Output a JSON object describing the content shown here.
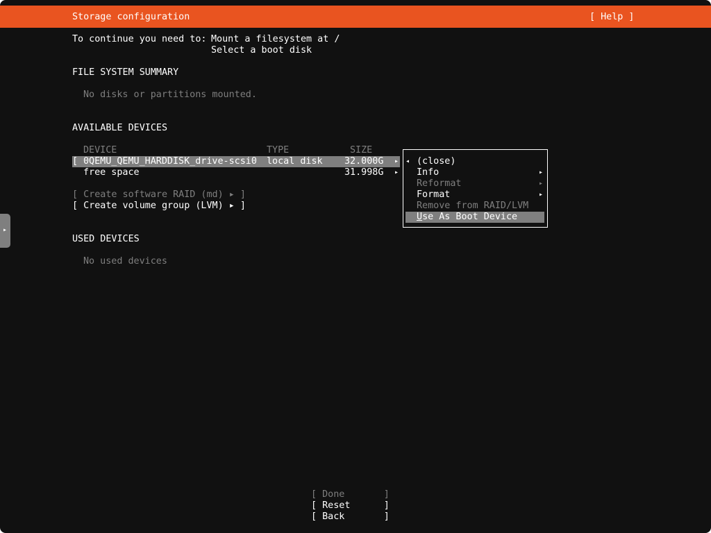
{
  "header": {
    "title": "Storage configuration",
    "help": "[ Help ]"
  },
  "intro": {
    "prefix": "To continue you need to:",
    "requirement_1": "Mount a filesystem at /",
    "requirement_2": "Select a boot disk"
  },
  "fs_summary": {
    "heading": "FILE SYSTEM SUMMARY",
    "empty": "No disks or partitions mounted."
  },
  "available": {
    "heading": "AVAILABLE DEVICES",
    "columns": [
      "DEVICE",
      "TYPE",
      "SIZE"
    ],
    "rows": [
      {
        "bracket": "[",
        "device": "0QEMU_QEMU_HARDDISK_drive-scsi0",
        "type": "local disk",
        "size": "32.000G",
        "arrow": "▸"
      },
      {
        "bracket": "",
        "device": "free space",
        "type": "",
        "size": "31.998G",
        "arrow": "▸"
      }
    ],
    "create_raid": "[ Create software RAID (md) ▸ ]",
    "create_lvm": "[ Create volume group (LVM) ▸ ]"
  },
  "used": {
    "heading": "USED DEVICES",
    "empty": "No used devices"
  },
  "context_menu": {
    "items": [
      {
        "label": "(close)",
        "lead": "◂",
        "arrow": "",
        "enabled": true
      },
      {
        "label": "Info",
        "lead": "",
        "arrow": "▸",
        "enabled": true
      },
      {
        "label": "Reformat",
        "lead": "",
        "arrow": "▸",
        "enabled": false
      },
      {
        "label": "Format",
        "lead": "",
        "arrow": "▸",
        "enabled": true
      },
      {
        "label": "Remove from RAID/LVM",
        "lead": "",
        "arrow": "",
        "enabled": false
      },
      {
        "label_first": "U",
        "label_rest": "se As Boot Device",
        "lead": "",
        "arrow": "",
        "enabled": true,
        "selected": true
      }
    ]
  },
  "footer": {
    "done": "[ Done       ]",
    "reset": "[ Reset      ]",
    "back": "[ Back       ]"
  },
  "side_tab": {
    "icon": "arrow-right-icon",
    "glyph": "▸"
  },
  "colors": {
    "accent": "#e95420",
    "background": "#111111",
    "highlight": "#7f7f7f",
    "disabled_text": "#7f7f7f"
  }
}
